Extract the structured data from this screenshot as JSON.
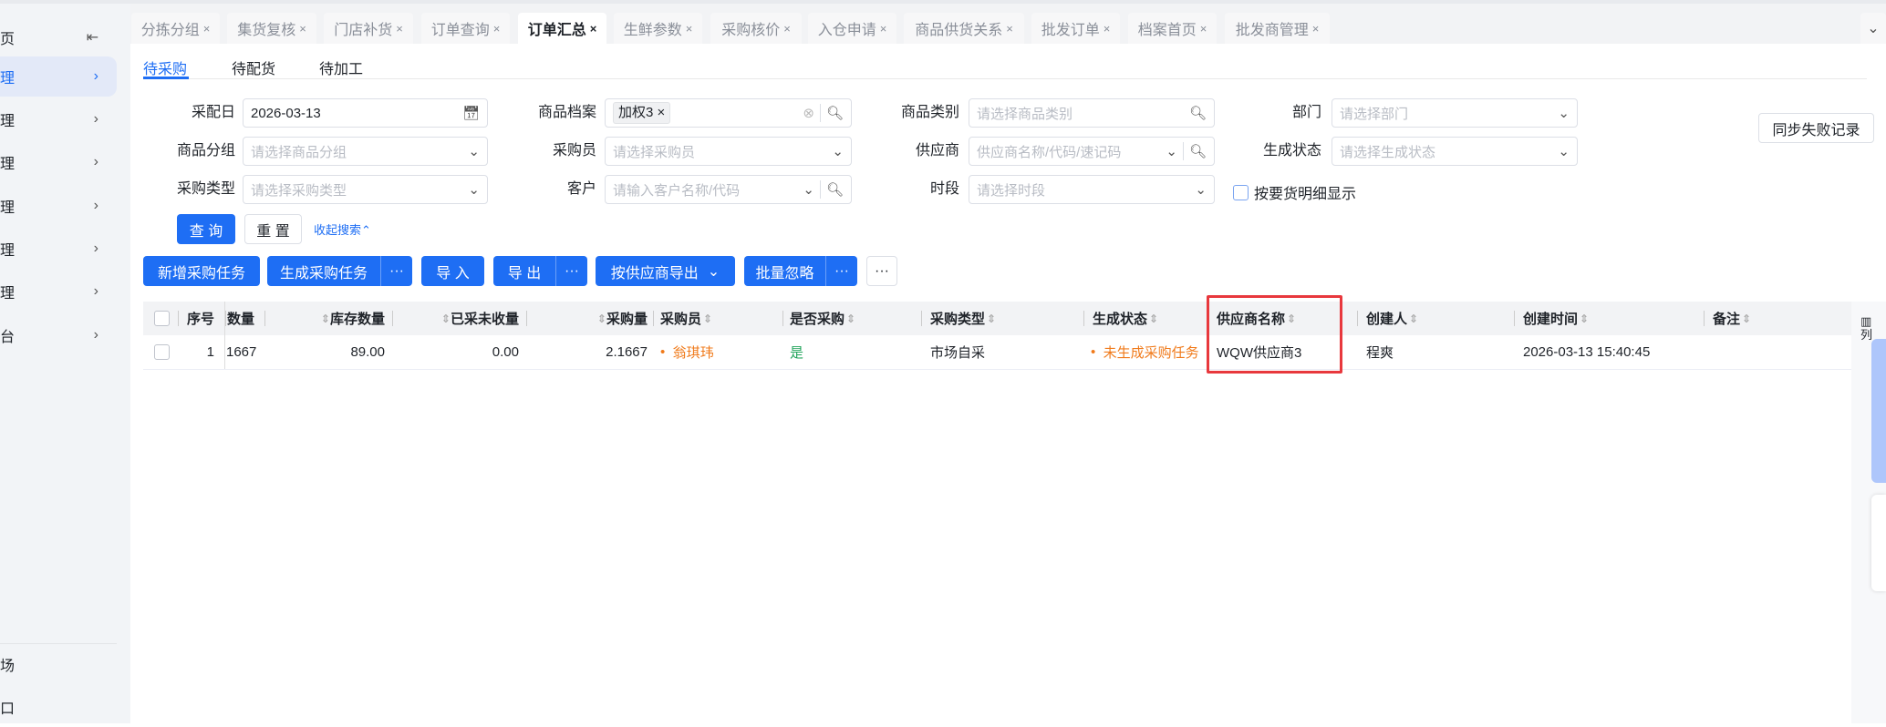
{
  "sidebar": {
    "items": [
      {
        "label": "页"
      },
      {
        "label": "理"
      },
      {
        "label": "理"
      },
      {
        "label": "理"
      },
      {
        "label": "理"
      },
      {
        "label": "理"
      },
      {
        "label": "理"
      },
      {
        "label": "台"
      }
    ],
    "bottom": [
      {
        "label": "场"
      },
      {
        "label": "口"
      }
    ],
    "collapse_icon": "collapse-left-icon"
  },
  "tabs": [
    {
      "label": "分拣分组"
    },
    {
      "label": "集货复核"
    },
    {
      "label": "门店补货"
    },
    {
      "label": "订单查询"
    },
    {
      "label": "订单汇总"
    },
    {
      "label": "生鲜参数"
    },
    {
      "label": "采购核价"
    },
    {
      "label": "入仓申请"
    },
    {
      "label": "商品供货关系"
    },
    {
      "label": "批发订单"
    },
    {
      "label": "档案首页"
    },
    {
      "label": "批发商管理"
    }
  ],
  "close_glyph": "×",
  "subtabs": [
    {
      "label": "待采购"
    },
    {
      "label": "待配货"
    },
    {
      "label": "待加工"
    }
  ],
  "filters": {
    "date": {
      "label": "采配日",
      "value": "2026-03-13"
    },
    "product": {
      "label": "商品档案",
      "tag": "加权3"
    },
    "category": {
      "label": "商品类别",
      "placeholder": "请选择商品类别"
    },
    "dept": {
      "label": "部门",
      "placeholder": "请选择部门"
    },
    "group": {
      "label": "商品分组",
      "placeholder": "请选择商品分组"
    },
    "buyer": {
      "label": "采购员",
      "placeholder": "请选择采购员"
    },
    "supplier": {
      "label": "供应商",
      "placeholder": "供应商名称/代码/速记码"
    },
    "gen_status": {
      "label": "生成状态",
      "placeholder": "请选择生成状态"
    },
    "ptype": {
      "label": "采购类型",
      "placeholder": "请选择采购类型"
    },
    "customer": {
      "label": "客户",
      "placeholder": "请输入客户名称/代码"
    },
    "period": {
      "label": "时段",
      "placeholder": "请选择时段"
    },
    "detail_checkbox": {
      "label": "按要货明细显示",
      "checked": false
    }
  },
  "search_btn": "查 询",
  "reset_btn": "重 置",
  "collapse_search": "收起搜索⌃",
  "sync_fail_btn": "同步失败记录",
  "actions": {
    "add": "新增采购任务",
    "generate": "生成采购任务",
    "import": "导 入",
    "export": "导 出",
    "export_by_supplier": "按供应商导出",
    "batch_ignore": "批量忽略",
    "more": "···"
  },
  "table": {
    "headers": [
      "序号",
      "数量",
      "库存数量",
      "已采未收量",
      "采购量",
      "采购员",
      "是否采购",
      "采购类型",
      "生成状态",
      "供应商名称",
      "创建人",
      "创建时间",
      "备注"
    ],
    "rows": [
      {
        "seq": "1",
        "qty": "1667",
        "stock": "89.00",
        "pending": "0.00",
        "purchase_qty": "2.1667",
        "buyer": "翁琪玮",
        "is_purchase": "是",
        "ptype": "市场自采",
        "status": "未生成采购任务",
        "supplier": "WQW供应商3",
        "creator": "程爽",
        "created": "2026-03-13 15:40:45",
        "remark": ""
      }
    ]
  },
  "column_setting": "列",
  "colors": {
    "primary": "#1e6ef4",
    "highlight": "#e8383d",
    "orange": "#f07a1a",
    "green": "#20a35a"
  }
}
